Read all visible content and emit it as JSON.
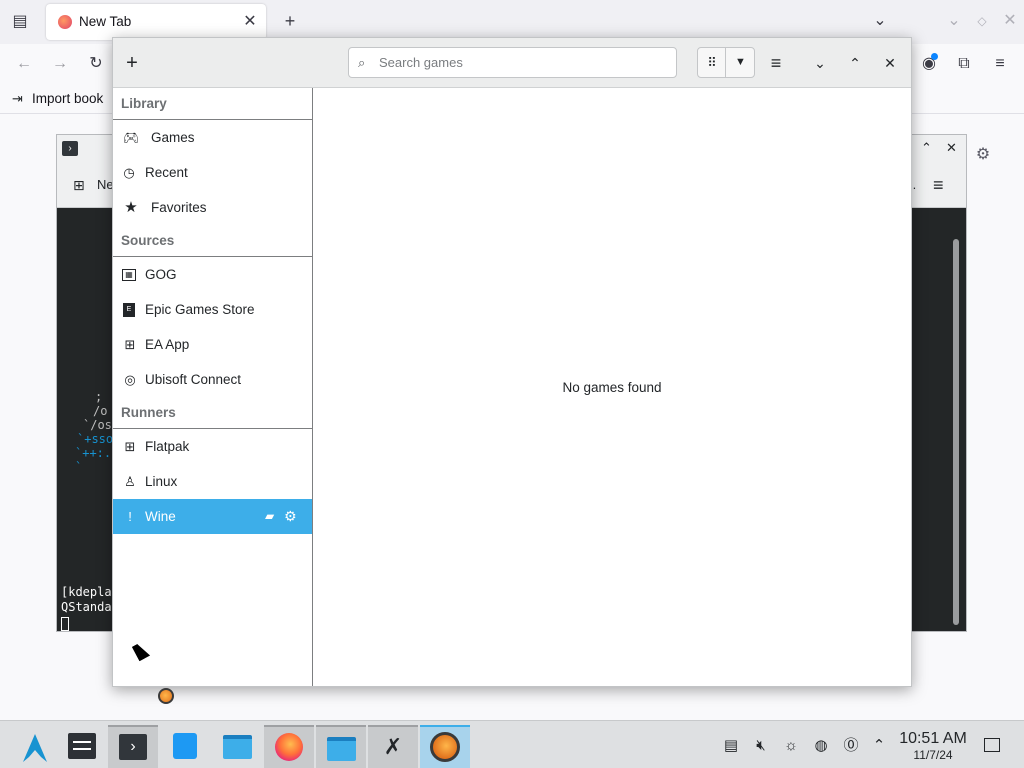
{
  "firefox": {
    "tab_title": "New Tab",
    "bookmark_label": "Import book"
  },
  "konsole": {
    "toolbar_new_label": "Ne",
    "toolbar_more": "..",
    "term_lines": [
      "[kdepla",
      "QStanda"
    ],
    "ascii_lines": [
      "  ;",
      "   /o",
      "  `/os",
      " `+sso",
      "`++:.",
      " `"
    ]
  },
  "lutris": {
    "search": {
      "placeholder": "Search games",
      "value": ""
    },
    "sidebar": {
      "sections": [
        {
          "title": "Library",
          "items": [
            {
              "label": "Games",
              "icon": "gamepad-icon"
            },
            {
              "label": "Recent",
              "icon": "clock-icon"
            },
            {
              "label": "Favorites",
              "icon": "star-icon"
            }
          ]
        },
        {
          "title": "Sources",
          "items": [
            {
              "label": "GOG",
              "icon": "gog-icon"
            },
            {
              "label": "Epic Games Store",
              "icon": "epic-icon"
            },
            {
              "label": "EA App",
              "icon": "ea-icon"
            },
            {
              "label": "Ubisoft Connect",
              "icon": "ubisoft-icon"
            }
          ]
        },
        {
          "title": "Runners",
          "items": [
            {
              "label": "Flatpak",
              "icon": "flatpak-icon"
            },
            {
              "label": "Linux",
              "icon": "linux-icon"
            },
            {
              "label": "Wine",
              "icon": "wine-icon",
              "selected": true
            }
          ]
        }
      ]
    },
    "main": {
      "empty_message": "No games found"
    }
  },
  "taskbar": {
    "clock_time": "10:51 AM",
    "clock_date": "11/7/24"
  },
  "colors": {
    "accent": "#3daee9",
    "terminal_bg": "#232627",
    "taskbar_bg": "#dee0e2"
  }
}
